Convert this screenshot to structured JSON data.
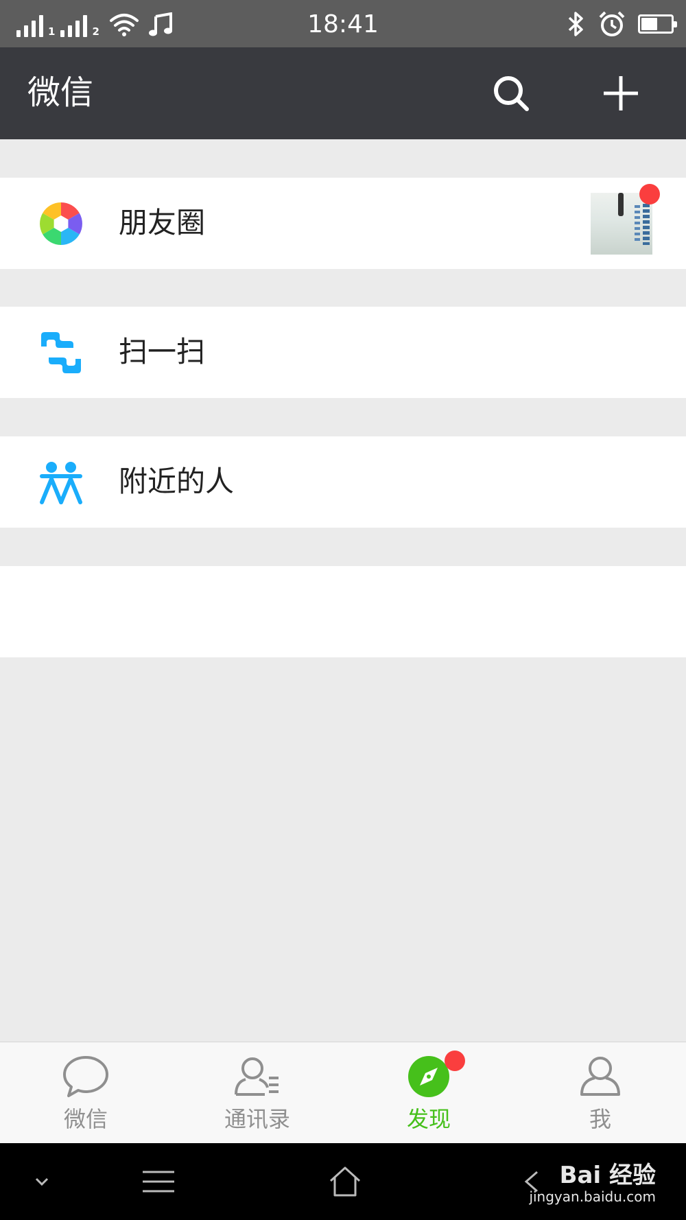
{
  "status_bar": {
    "time": "18:41",
    "sim1_label": "1",
    "sim2_label": "2",
    "icons": [
      "signal-sim1-icon",
      "signal-sim2-icon",
      "wifi-icon",
      "music-note-icon",
      "bluetooth-icon",
      "alarm-icon",
      "battery-icon"
    ],
    "battery_level": 0.55
  },
  "header": {
    "title": "微信",
    "search_icon": "search-icon",
    "add_icon": "plus-icon",
    "background": "#393a3f"
  },
  "discover": {
    "items": [
      {
        "label": "朋友圈",
        "icon": "moments-aperture-icon",
        "has_thumbnail": true,
        "has_badge": true
      },
      {
        "label": "扫一扫",
        "icon": "scan-icon"
      },
      {
        "label": "附近的人",
        "icon": "people-nearby-icon"
      },
      {
        "label": ""
      }
    ]
  },
  "tab_bar": {
    "tabs": [
      {
        "label": "微信",
        "icon": "chat-bubble-icon",
        "active": false
      },
      {
        "label": "通讯录",
        "icon": "contacts-icon",
        "active": false
      },
      {
        "label": "发现",
        "icon": "compass-icon",
        "active": true,
        "has_badge": true
      },
      {
        "label": "我",
        "icon": "person-icon",
        "active": false
      }
    ],
    "active_color": "#46c01b",
    "inactive_color": "#8f8f8f"
  },
  "nav_bar": {
    "icons": [
      "collapse-chevron-icon",
      "menu-icon",
      "home-icon",
      "back-icon"
    ]
  },
  "watermark": {
    "main": "Bai 经验",
    "sub": "jingyan.baidu.com"
  },
  "colors": {
    "badge": "#fa3e3e",
    "accent_blue": "#1aadfb",
    "background": "#ebebeb"
  }
}
